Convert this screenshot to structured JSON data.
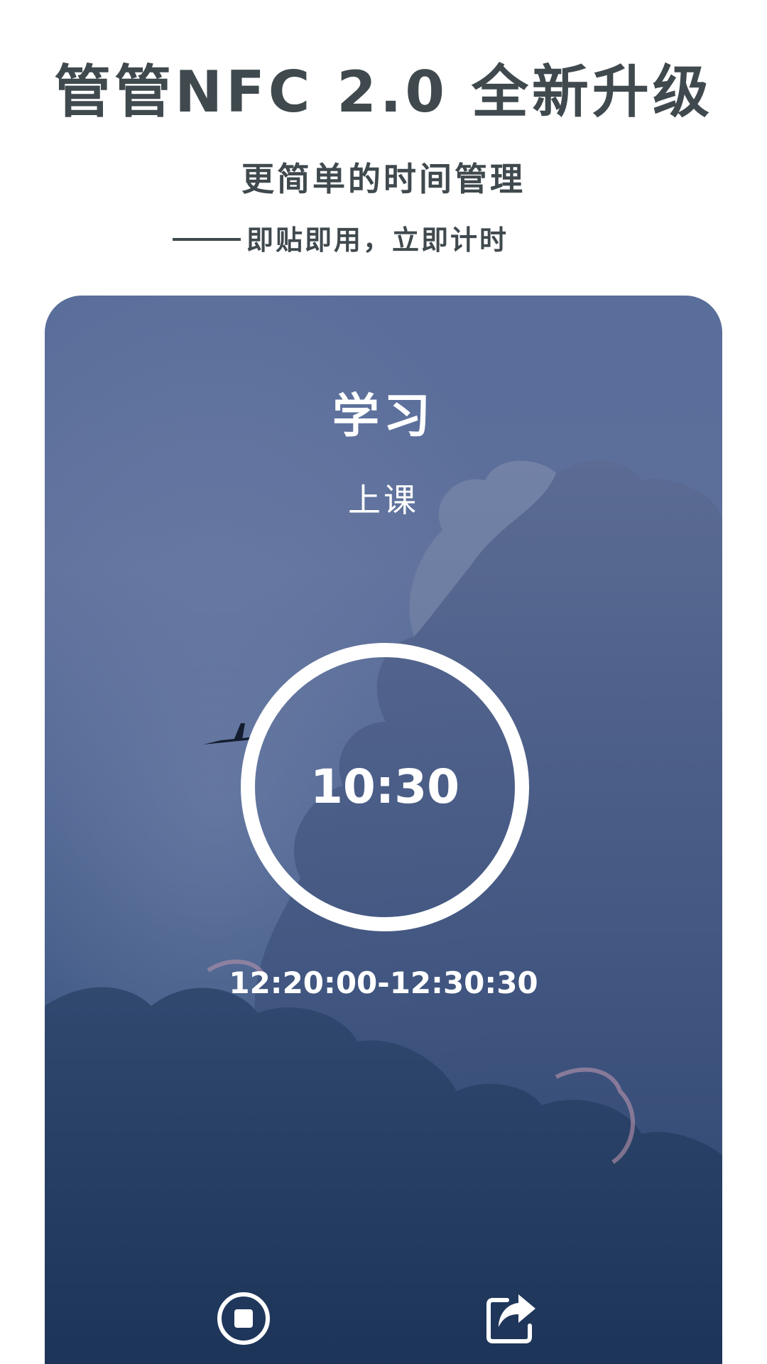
{
  "promo": {
    "headline": "管管NFC 2.0 全新升级",
    "subhead": "更简单的时间管理",
    "tagline": "即贴即用，立即计时"
  },
  "card": {
    "activity_title": "学习",
    "activity_sub": "上课",
    "timer": "10:30",
    "time_range": "12:20:00-12:30:30",
    "controls": [
      {
        "label": "结束",
        "icon": "stop-icon"
      },
      {
        "label": "分享",
        "icon": "share-icon"
      }
    ]
  },
  "colors": {
    "text_dark": "#3f494e",
    "sky_top": "#5a6e9b",
    "sky_bottom": "#1f375c",
    "white": "#ffffff"
  }
}
